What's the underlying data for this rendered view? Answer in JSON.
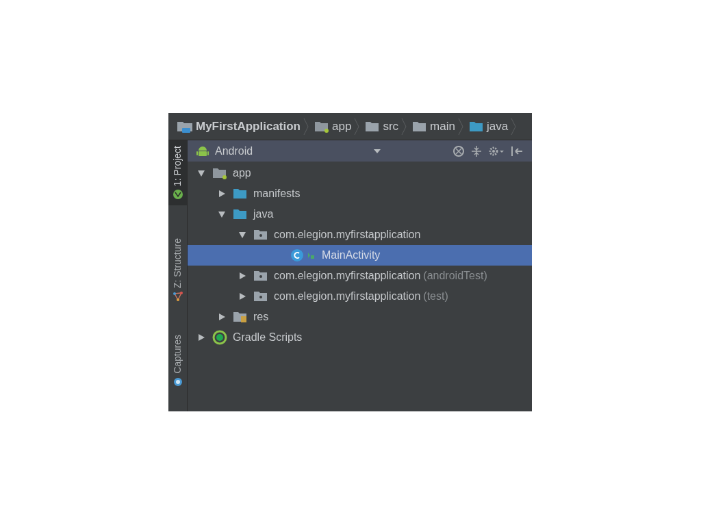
{
  "breadcrumbs": [
    {
      "label": "MyFirstApplication",
      "kind": "project"
    },
    {
      "label": "app",
      "kind": "module"
    },
    {
      "label": "src",
      "kind": "folder"
    },
    {
      "label": "main",
      "kind": "folder"
    },
    {
      "label": "java",
      "kind": "source"
    }
  ],
  "tool_tabs": [
    {
      "label": "1: Project",
      "kind": "android",
      "selected": true
    },
    {
      "label": "Z: Structure",
      "kind": "structure",
      "selected": false
    },
    {
      "label": "Captures",
      "kind": "captures",
      "selected": false
    }
  ],
  "view_selector": {
    "value": "Android"
  },
  "tree": [
    {
      "label": "app",
      "kind": "module",
      "expanded": true,
      "selected": false,
      "children": [
        {
          "label": "manifests",
          "kind": "source",
          "expanded": false,
          "selected": false
        },
        {
          "label": "java",
          "kind": "source",
          "expanded": true,
          "selected": false,
          "children": [
            {
              "label": "com.elegion.myfirstapplication",
              "kind": "package",
              "expanded": true,
              "selected": false,
              "children": [
                {
                  "label": "MainActivity",
                  "kind": "class",
                  "selected": true
                }
              ]
            },
            {
              "label": "com.elegion.myfirstapplication",
              "suffix": "(androidTest)",
              "kind": "package",
              "expanded": false,
              "selected": false
            },
            {
              "label": "com.elegion.myfirstapplication",
              "suffix": "(test)",
              "kind": "package",
              "expanded": false,
              "selected": false
            }
          ]
        },
        {
          "label": "res",
          "kind": "res",
          "expanded": false,
          "selected": false
        }
      ]
    },
    {
      "label": "Gradle Scripts",
      "kind": "gradle",
      "expanded": false,
      "selected": false
    }
  ]
}
